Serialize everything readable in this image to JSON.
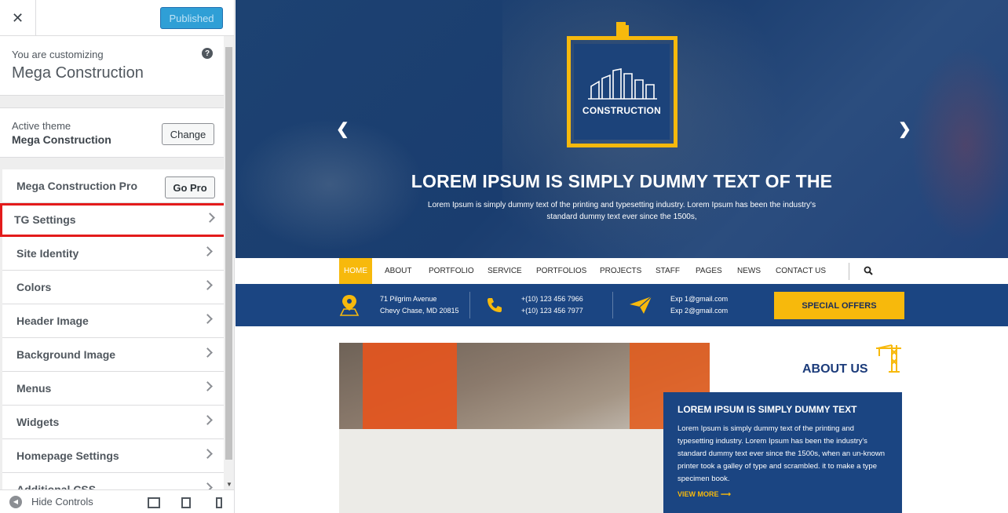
{
  "customizer": {
    "close_icon": "close-icon",
    "publish_label": "Published",
    "customizing_label": "You are customizing",
    "site_name": "Mega Construction",
    "active_theme_label": "Active theme",
    "active_theme_name": "Mega Construction",
    "change_label": "Change",
    "pro_label": "Mega Construction Pro",
    "go_pro_label": "Go Pro",
    "panels": [
      "TG Settings",
      "Site Identity",
      "Colors",
      "Header Image",
      "Background Image",
      "Menus",
      "Widgets",
      "Homepage Settings",
      "Additional CSS"
    ],
    "hide_controls_label": "Hide Controls",
    "highlight_color": "#e31b1b",
    "accent_color": "#2f9fd6"
  },
  "site": {
    "brand": "CONSTRUCTION",
    "hero_title": "LOREM IPSUM IS SIMPLY DUMMY TEXT OF THE",
    "hero_subtitle": "Lorem Ipsum is simply dummy text of the printing and typesetting industry. Lorem Ipsum has been the industry's standard dummy text ever since the 1500s,",
    "nav": [
      "HOME",
      "ABOUT",
      "PORTFOLIO",
      "SERVICE",
      "PORTFOLIOS",
      "PROJECTS",
      "STAFF",
      "PAGES",
      "NEWS",
      "CONTACT US"
    ],
    "address_line1": "71 Pilgrim Avenue",
    "address_line2": "Chevy Chase, MD 20815",
    "phone1": "+(10) 123 456 7966",
    "phone2": "+(10) 123 456 7977",
    "email1": "Exp 1@gmail.com",
    "email2": "Exp 2@gmail.com",
    "special_offers": "SPECIAL OFFERS",
    "about_title": "ABOUT US",
    "about_heading": "LOREM IPSUM IS SIMPLY DUMMY TEXT",
    "about_text": "Lorem Ipsum is simply dummy text of the printing and typesetting industry. Lorem Ipsum has been the industry's standard dummy text ever since the 1500s, when an un-known printer took a galley of type and scrambled. it to make a type specimen book.",
    "view_more": "VIEW MORE ⟶",
    "brand_blue": "#1b4582",
    "brand_yellow": "#f7b90c"
  }
}
